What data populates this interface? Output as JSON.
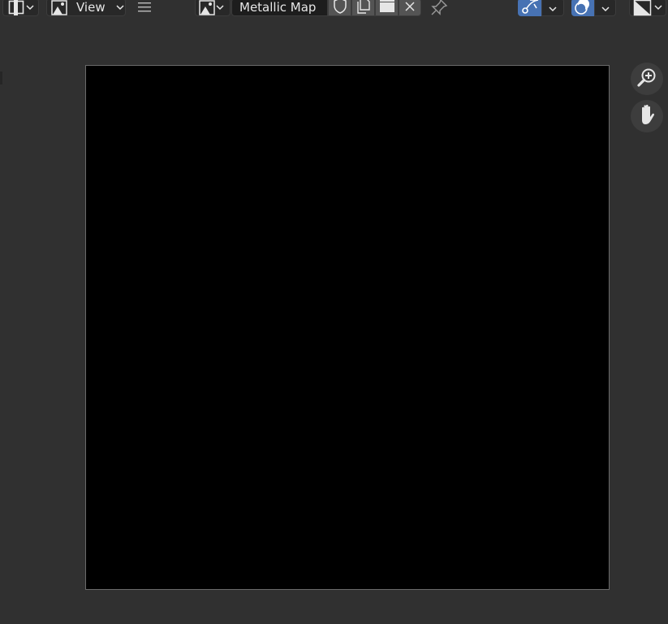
{
  "header": {
    "editor_type_icon": "image-editor-icon",
    "view_menu_label": "View",
    "image_name": "Metallic Map",
    "fake_user_icon": "shield-icon",
    "duplicate_icon": "duplicate-image-icon",
    "open_icon": "folder-icon",
    "unlink_icon": "close-icon",
    "pin_icon": "pin-icon",
    "gizmo_icon": "gizmo-icon",
    "overlay_icon": "overlay-icon",
    "display_channels_icon": "display-channels-icon"
  },
  "navigation": {
    "zoom_icon": "zoom-icon",
    "pan_icon": "hand-icon"
  },
  "colors": {
    "background": "#303030",
    "canvas": "#000000",
    "accent": "#4772b3"
  }
}
